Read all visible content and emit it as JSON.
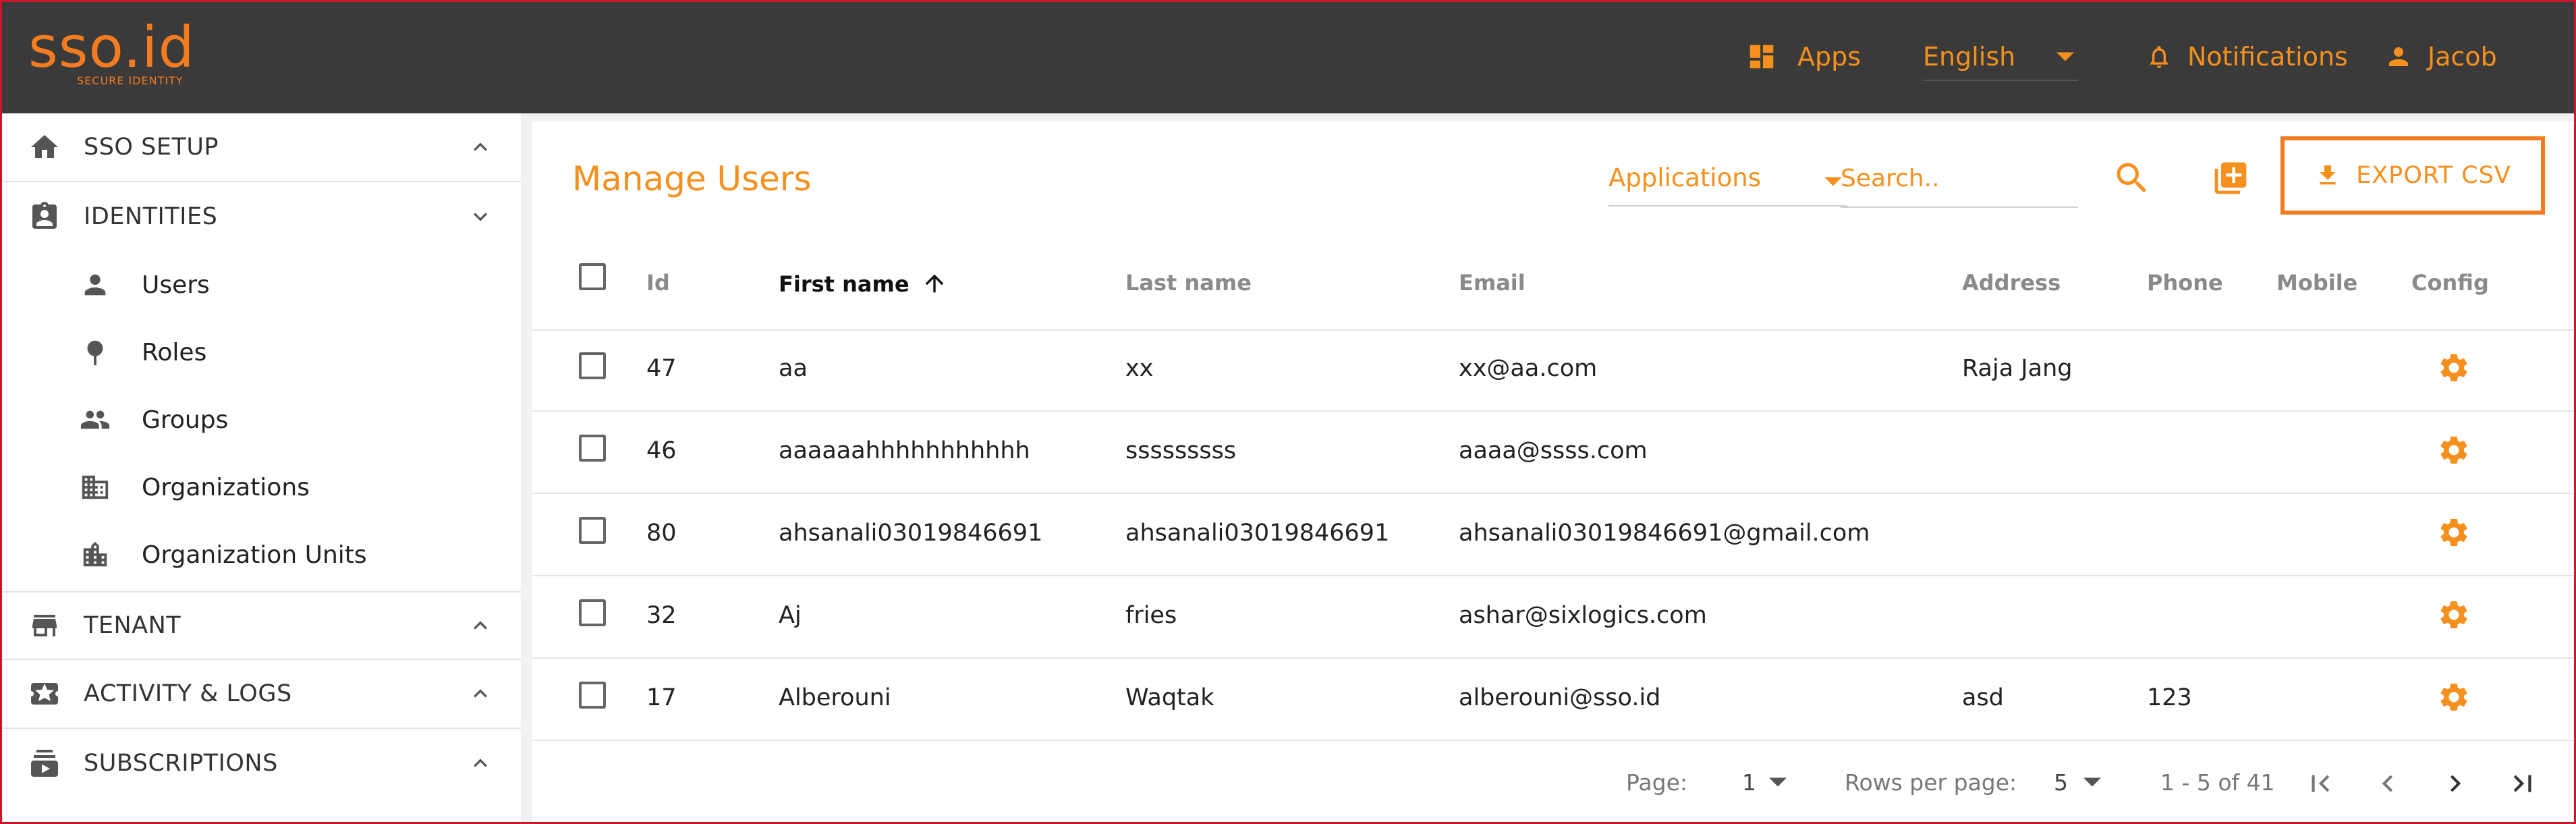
{
  "header": {
    "logo_text": "sso.id",
    "logo_tagline": "SECURE IDENTITY",
    "apps_label": "Apps",
    "language_value": "English",
    "notifications_label": "Notifications",
    "user_name": "Jacob"
  },
  "sidebar": {
    "sections": [
      {
        "label": "SSO SETUP",
        "icon": "home-icon",
        "expanded": false
      },
      {
        "label": "IDENTITIES",
        "icon": "badge-icon",
        "expanded": true
      },
      {
        "label": "TENANT",
        "icon": "store-icon",
        "expanded": false
      },
      {
        "label": "ACTIVITY & LOGS",
        "icon": "ticket-icon",
        "expanded": false
      },
      {
        "label": "SUBSCRIPTIONS",
        "icon": "subscriptions-icon",
        "expanded": false
      }
    ],
    "identity_items": [
      {
        "label": "Users",
        "icon": "person-icon"
      },
      {
        "label": "Roles",
        "icon": "pin-icon"
      },
      {
        "label": "Groups",
        "icon": "group-icon"
      },
      {
        "label": "Organizations",
        "icon": "building-icon"
      },
      {
        "label": "Organization Units",
        "icon": "city-icon"
      }
    ]
  },
  "main": {
    "title": "Manage Users",
    "applications_select": "Applications",
    "search_placeholder": "Search..",
    "export_label": "EXPORT CSV",
    "columns": [
      "Id",
      "First name",
      "Last name",
      "Email",
      "Address",
      "Phone",
      "Mobile",
      "Config"
    ],
    "sorted_column": "First name",
    "sort_direction": "ascending",
    "rows": [
      {
        "id": "47",
        "first": "aa",
        "last": "xx",
        "email": "xx@aa.com",
        "address": "Raja Jang",
        "phone": "",
        "mobile": ""
      },
      {
        "id": "46",
        "first": "aaaaaahhhhhhhhhhh",
        "last": "sssssssss",
        "email": "aaaa@ssss.com",
        "address": "",
        "phone": "",
        "mobile": ""
      },
      {
        "id": "80",
        "first": "ahsanali03019846691",
        "last": "ahsanali03019846691",
        "email": "ahsanali03019846691@gmail.com",
        "address": "",
        "phone": "",
        "mobile": ""
      },
      {
        "id": "32",
        "first": "Aj",
        "last": "fries",
        "email": "ashar@sixlogics.com",
        "address": "",
        "phone": "",
        "mobile": ""
      },
      {
        "id": "17",
        "first": "Alberouni",
        "last": "Waqtak",
        "email": "alberouni@sso.id",
        "address": "asd",
        "phone": "123",
        "mobile": ""
      }
    ]
  },
  "pagination": {
    "page_label": "Page:",
    "page_value": "1",
    "rows_label": "Rows per page:",
    "rows_value": "5",
    "range": "1 - 5 of 41"
  },
  "colors": {
    "accent": "#f5901e",
    "header_bg": "#3a3a3a",
    "sidebar_bg": "#ffffff",
    "page_bg": "#f2f2f2"
  }
}
